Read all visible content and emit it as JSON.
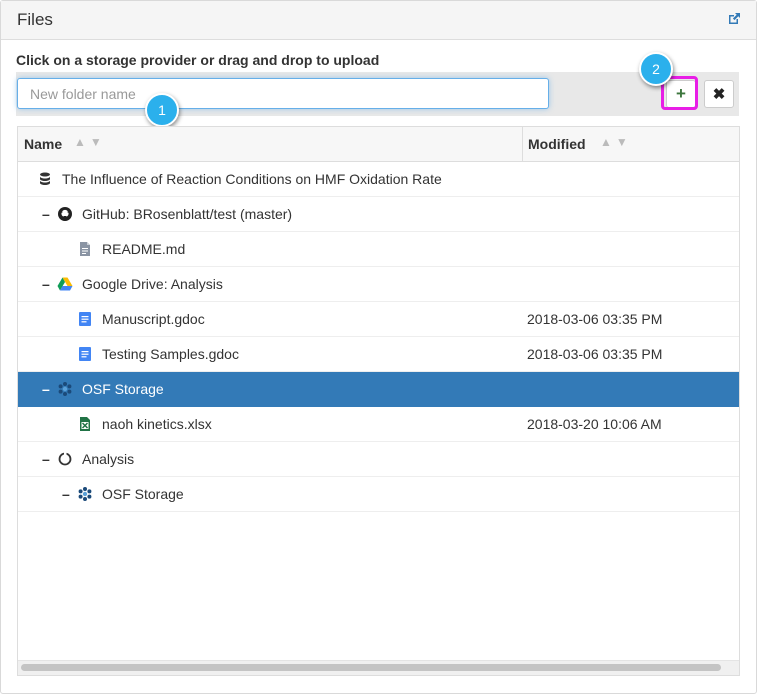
{
  "panel": {
    "title": "Files",
    "external_link_icon": "external-link-icon"
  },
  "instruction": "Click on a storage provider or drag and drop to upload",
  "folder_input": {
    "value": "",
    "placeholder": "New folder name"
  },
  "buttons": {
    "add": "+",
    "close": "✖"
  },
  "annotations": {
    "marker1": "1",
    "marker2": "2",
    "highlight_color": "#e81ee6",
    "marker_color": "#2bb0ec"
  },
  "columns": {
    "name": "Name",
    "modified": "Modified"
  },
  "rows": [
    {
      "label": "The Influence of Reaction Conditions on HMF Oxidation Rate",
      "icon": "database-icon",
      "toggle": "",
      "modified": "",
      "depth": 0
    },
    {
      "label": "GitHub: BRosenblatt/test (master)",
      "icon": "github-icon",
      "toggle": "–",
      "modified": "",
      "depth": 1
    },
    {
      "label": "README.md",
      "icon": "file-icon",
      "toggle": "",
      "modified": "",
      "depth": 2
    },
    {
      "label": "Google Drive: Analysis",
      "icon": "google-drive-icon",
      "toggle": "–",
      "modified": "",
      "depth": 1
    },
    {
      "label": "Manuscript.gdoc",
      "icon": "gdoc-icon",
      "toggle": "",
      "modified": "2018-03-06 03:35 PM",
      "depth": 2
    },
    {
      "label": "Testing Samples.gdoc",
      "icon": "gdoc-icon",
      "toggle": "",
      "modified": "2018-03-06 03:35 PM",
      "depth": 2
    },
    {
      "label": "OSF Storage",
      "icon": "osf-icon",
      "toggle": "–",
      "modified": "",
      "depth": 1,
      "selected": true
    },
    {
      "label": "naoh kinetics.xlsx",
      "icon": "excel-icon",
      "toggle": "",
      "modified": "2018-03-20 10:06 AM",
      "depth": 2
    },
    {
      "label": "Analysis",
      "icon": "circle-icon",
      "toggle": "–",
      "modified": "",
      "depth": 1
    },
    {
      "label": "OSF Storage",
      "icon": "osf-icon",
      "toggle": "–",
      "modified": "",
      "depth": 2
    }
  ],
  "colors": {
    "selected_row": "#337ab7",
    "add_icon": "#3c763d"
  }
}
